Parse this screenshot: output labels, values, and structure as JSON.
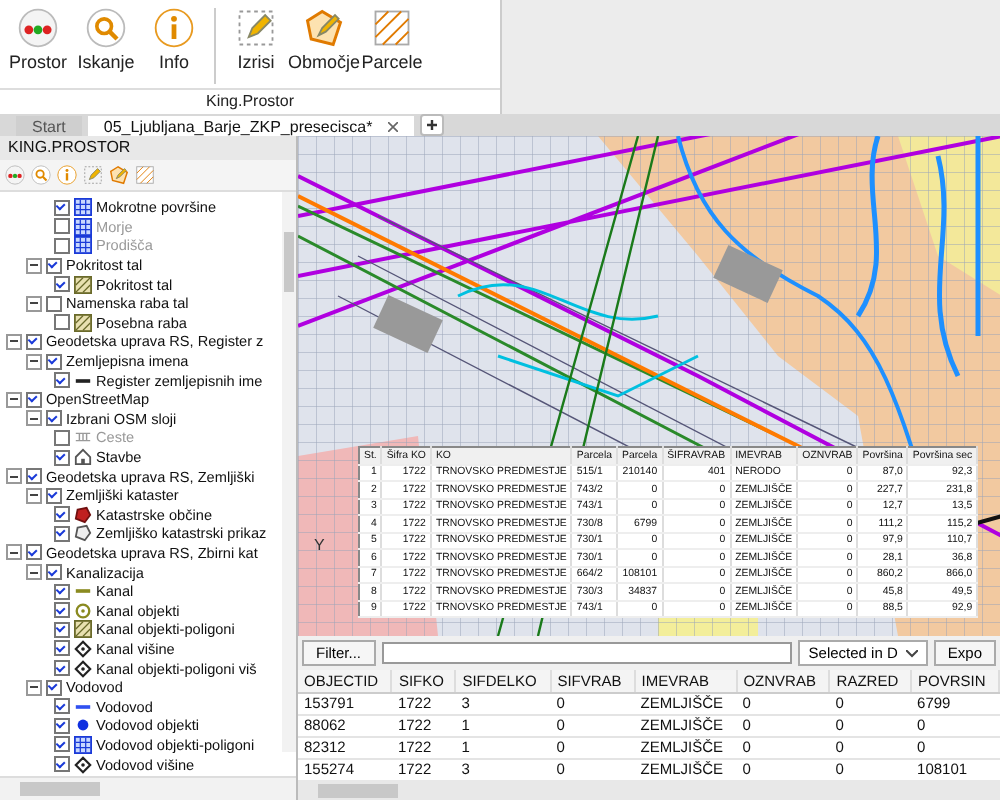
{
  "ribbon": {
    "buttons": [
      {
        "label": "Prostor",
        "kind": "prostor"
      },
      {
        "label": "Iskanje",
        "kind": "search"
      },
      {
        "label": "Info",
        "kind": "info"
      },
      {
        "label": "Izrisi",
        "kind": "draw"
      },
      {
        "label": "Območje",
        "kind": "area"
      },
      {
        "label": "Parcele",
        "kind": "parcels"
      }
    ],
    "group_label": "King.Prostor"
  },
  "tabs": [
    {
      "label": "Start",
      "selected": false,
      "closable": false
    },
    {
      "label": "05_Ljubljana_Barje_ZKP_presecisca*",
      "selected": true,
      "closable": true
    }
  ],
  "panel": {
    "title": "KING.PROSTOR",
    "tools": [
      {
        "kind": "prostor"
      },
      {
        "kind": "search"
      },
      {
        "kind": "info"
      },
      {
        "kind": "draw"
      },
      {
        "kind": "area"
      },
      {
        "kind": "parcels"
      }
    ]
  },
  "tree": [
    {
      "children": [
        {
          "children": [
            {
              "label": "Mokrotne površine",
              "checked": true,
              "disabled": false,
              "kind": "blue-grid"
            },
            {
              "label": "Morje",
              "checked": false,
              "disabled": true,
              "kind": "blue-grid"
            },
            {
              "label": "Prodišča",
              "checked": false,
              "disabled": true,
              "kind": "blue-grid"
            }
          ]
        },
        {
          "label": "Pokritost tal",
          "checked": true,
          "expanded": true,
          "children": [
            {
              "label": "Pokritost tal",
              "checked": true,
              "disabled": false,
              "kind": "hatch"
            }
          ]
        },
        {
          "label": "Namenska raba tal",
          "checked": false,
          "expanded": true,
          "children": [
            {
              "label": "Posebna raba",
              "checked": false,
              "disabled": false,
              "kind": "hatch"
            }
          ]
        }
      ]
    },
    {
      "label": "Geodetska uprava RS, Register z",
      "checked": true,
      "expanded": true,
      "children": [
        {
          "label": "Zemljepisna imena",
          "checked": true,
          "expanded": true,
          "children": [
            {
              "label": "Register zemljepisnih ime",
              "checked": true,
              "disabled": false,
              "kind": "dash"
            }
          ]
        }
      ]
    },
    {
      "label": "OpenStreetMap",
      "checked": true,
      "expanded": true,
      "children": [
        {
          "label": "Izbrani OSM sloji",
          "checked": true,
          "expanded": true,
          "children": [
            {
              "label": "Ceste",
              "checked": false,
              "disabled": true,
              "kind": "road"
            },
            {
              "label": "Stavbe",
              "checked": true,
              "disabled": false,
              "kind": "house"
            }
          ]
        }
      ]
    },
    {
      "label": "Geodetska uprava RS, Zemljiški",
      "checked": true,
      "expanded": true,
      "children": [
        {
          "label": "Zemljiški kataster",
          "checked": true,
          "expanded": true,
          "children": [
            {
              "label": "Katastrske občine",
              "checked": true,
              "disabled": false,
              "kind": "blob"
            },
            {
              "label": "Zemljiško katastrski prikaz",
              "checked": true,
              "disabled": false,
              "kind": "outline"
            }
          ]
        }
      ]
    },
    {
      "label": "Geodetska uprava RS, Zbirni kat",
      "checked": true,
      "expanded": true,
      "children": [
        {
          "label": "Kanalizacija",
          "checked": true,
          "expanded": true,
          "children": [
            {
              "label": "Kanal",
              "checked": true,
              "disabled": false,
              "kind": "olive-line"
            },
            {
              "label": "Kanal objekti",
              "checked": true,
              "disabled": false,
              "kind": "ring"
            },
            {
              "label": "Kanal objekti-poligoni",
              "checked": true,
              "disabled": false,
              "kind": "hatch"
            },
            {
              "label": "Kanal višine",
              "checked": true,
              "disabled": false,
              "kind": "diamond"
            },
            {
              "label": "Kanal objekti-poligoni viš",
              "checked": true,
              "disabled": false,
              "kind": "diamond"
            }
          ]
        },
        {
          "label": "Vodovod",
          "checked": true,
          "expanded": true,
          "children": [
            {
              "label": "Vodovod",
              "checked": true,
              "disabled": false,
              "kind": "blue-line"
            },
            {
              "label": "Vodovod objekti",
              "checked": true,
              "disabled": false,
              "kind": "dot"
            },
            {
              "label": "Vodovod objekti-poligoni",
              "checked": true,
              "disabled": false,
              "kind": "blue-grid"
            },
            {
              "label": "Vodovod višine",
              "checked": true,
              "disabled": false,
              "kind": "diamond"
            }
          ]
        }
      ]
    }
  ],
  "map": {
    "axis_label": "Y",
    "overlay_table": {
      "columns": [
        "St.",
        "Šifra KO",
        "KO",
        "Parcela",
        "Parcela",
        "ŠIFRAVRAB",
        "IMEVRAB",
        "OZNVRAB",
        "Površina",
        "Površina sec"
      ],
      "rows": [
        [
          "1",
          "1722",
          "TRNOVSKO PREDMESTJE",
          "515/1",
          "210140",
          "401",
          "NERODO",
          "0",
          "87,0",
          "92,3"
        ],
        [
          "2",
          "1722",
          "TRNOVSKO PREDMESTJE",
          "743/2",
          "0",
          "0",
          "ZEMLJIŠČE",
          "0",
          "227,7",
          "231,8"
        ],
        [
          "3",
          "1722",
          "TRNOVSKO PREDMESTJE",
          "743/1",
          "0",
          "0",
          "ZEMLJIŠČE",
          "0",
          "12,7",
          "13,5"
        ],
        [
          "4",
          "1722",
          "TRNOVSKO PREDMESTJE",
          "730/8",
          "6799",
          "0",
          "ZEMLJIŠČE",
          "0",
          "111,2",
          "115,2"
        ],
        [
          "5",
          "1722",
          "TRNOVSKO PREDMESTJE",
          "730/1",
          "0",
          "0",
          "ZEMLJIŠČE",
          "0",
          "97,9",
          "110,7"
        ],
        [
          "6",
          "1722",
          "TRNOVSKO PREDMESTJE",
          "730/1",
          "0",
          "0",
          "ZEMLJIŠČE",
          "0",
          "28,1",
          "36,8"
        ],
        [
          "7",
          "1722",
          "TRNOVSKO PREDMESTJE",
          "664/2",
          "108101",
          "0",
          "ZEMLJIŠČE",
          "0",
          "860,2",
          "866,0"
        ],
        [
          "8",
          "1722",
          "TRNOVSKO PREDMESTJE",
          "730/3",
          "34837",
          "0",
          "ZEMLJIŠČE",
          "0",
          "45,8",
          "49,5"
        ],
        [
          "9",
          "1722",
          "TRNOVSKO PREDMESTJE",
          "743/1",
          "0",
          "0",
          "ZEMLJIŠČE",
          "0",
          "88,5",
          "92,9"
        ]
      ]
    }
  },
  "filter_bar": {
    "button": "Filter...",
    "dropdown": "Selected in D",
    "export": "Expo"
  },
  "table": {
    "columns": [
      "OBJECTID",
      "SIFKO",
      "SIFDELKO",
      "SIFVRAB",
      "IMEVRAB",
      "OZNVRAB",
      "RAZRED",
      "POVRSIN"
    ],
    "rows": [
      [
        "153791",
        "1722",
        "3",
        "0",
        "ZEMLJIŠČE",
        "0",
        "0",
        "6799"
      ],
      [
        "88062",
        "1722",
        "1",
        "0",
        "ZEMLJIŠČE",
        "0",
        "0",
        "0"
      ],
      [
        "82312",
        "1722",
        "1",
        "0",
        "ZEMLJIŠČE",
        "0",
        "0",
        "0"
      ],
      [
        "155274",
        "1722",
        "3",
        "0",
        "ZEMLJIŠČE",
        "0",
        "0",
        "108101"
      ]
    ]
  }
}
